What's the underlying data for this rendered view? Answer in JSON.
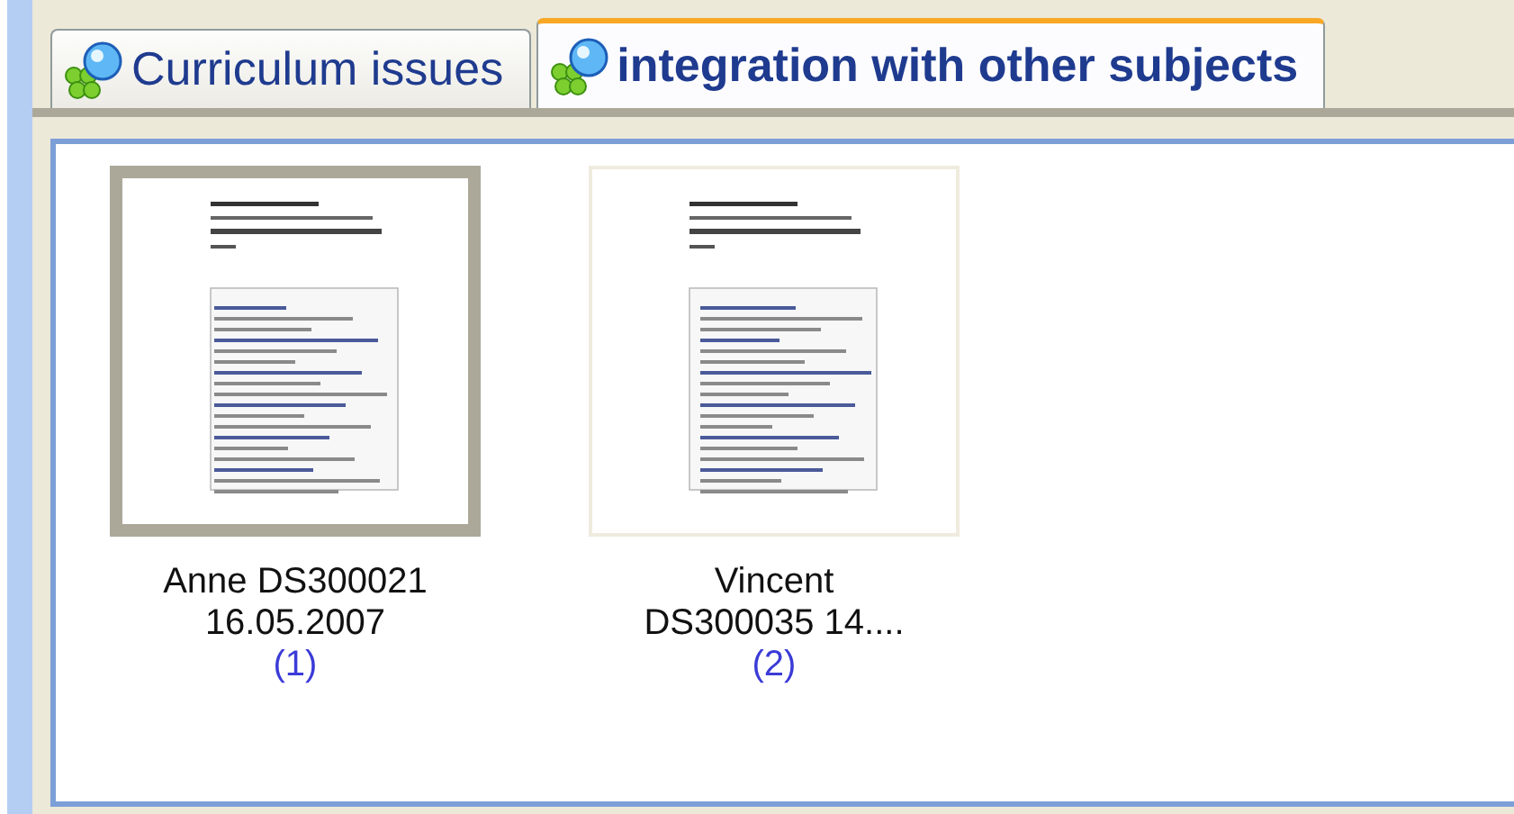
{
  "tabs": [
    {
      "label": "Curriculum issues",
      "selected": false
    },
    {
      "label": "integration with other subjects",
      "selected": true
    }
  ],
  "documents": [
    {
      "caption": "Anne DS300021 16.05.2007",
      "count": "(1)",
      "selected": true
    },
    {
      "caption": "Vincent DS300035 14....",
      "count": "(2)",
      "selected": false
    }
  ]
}
